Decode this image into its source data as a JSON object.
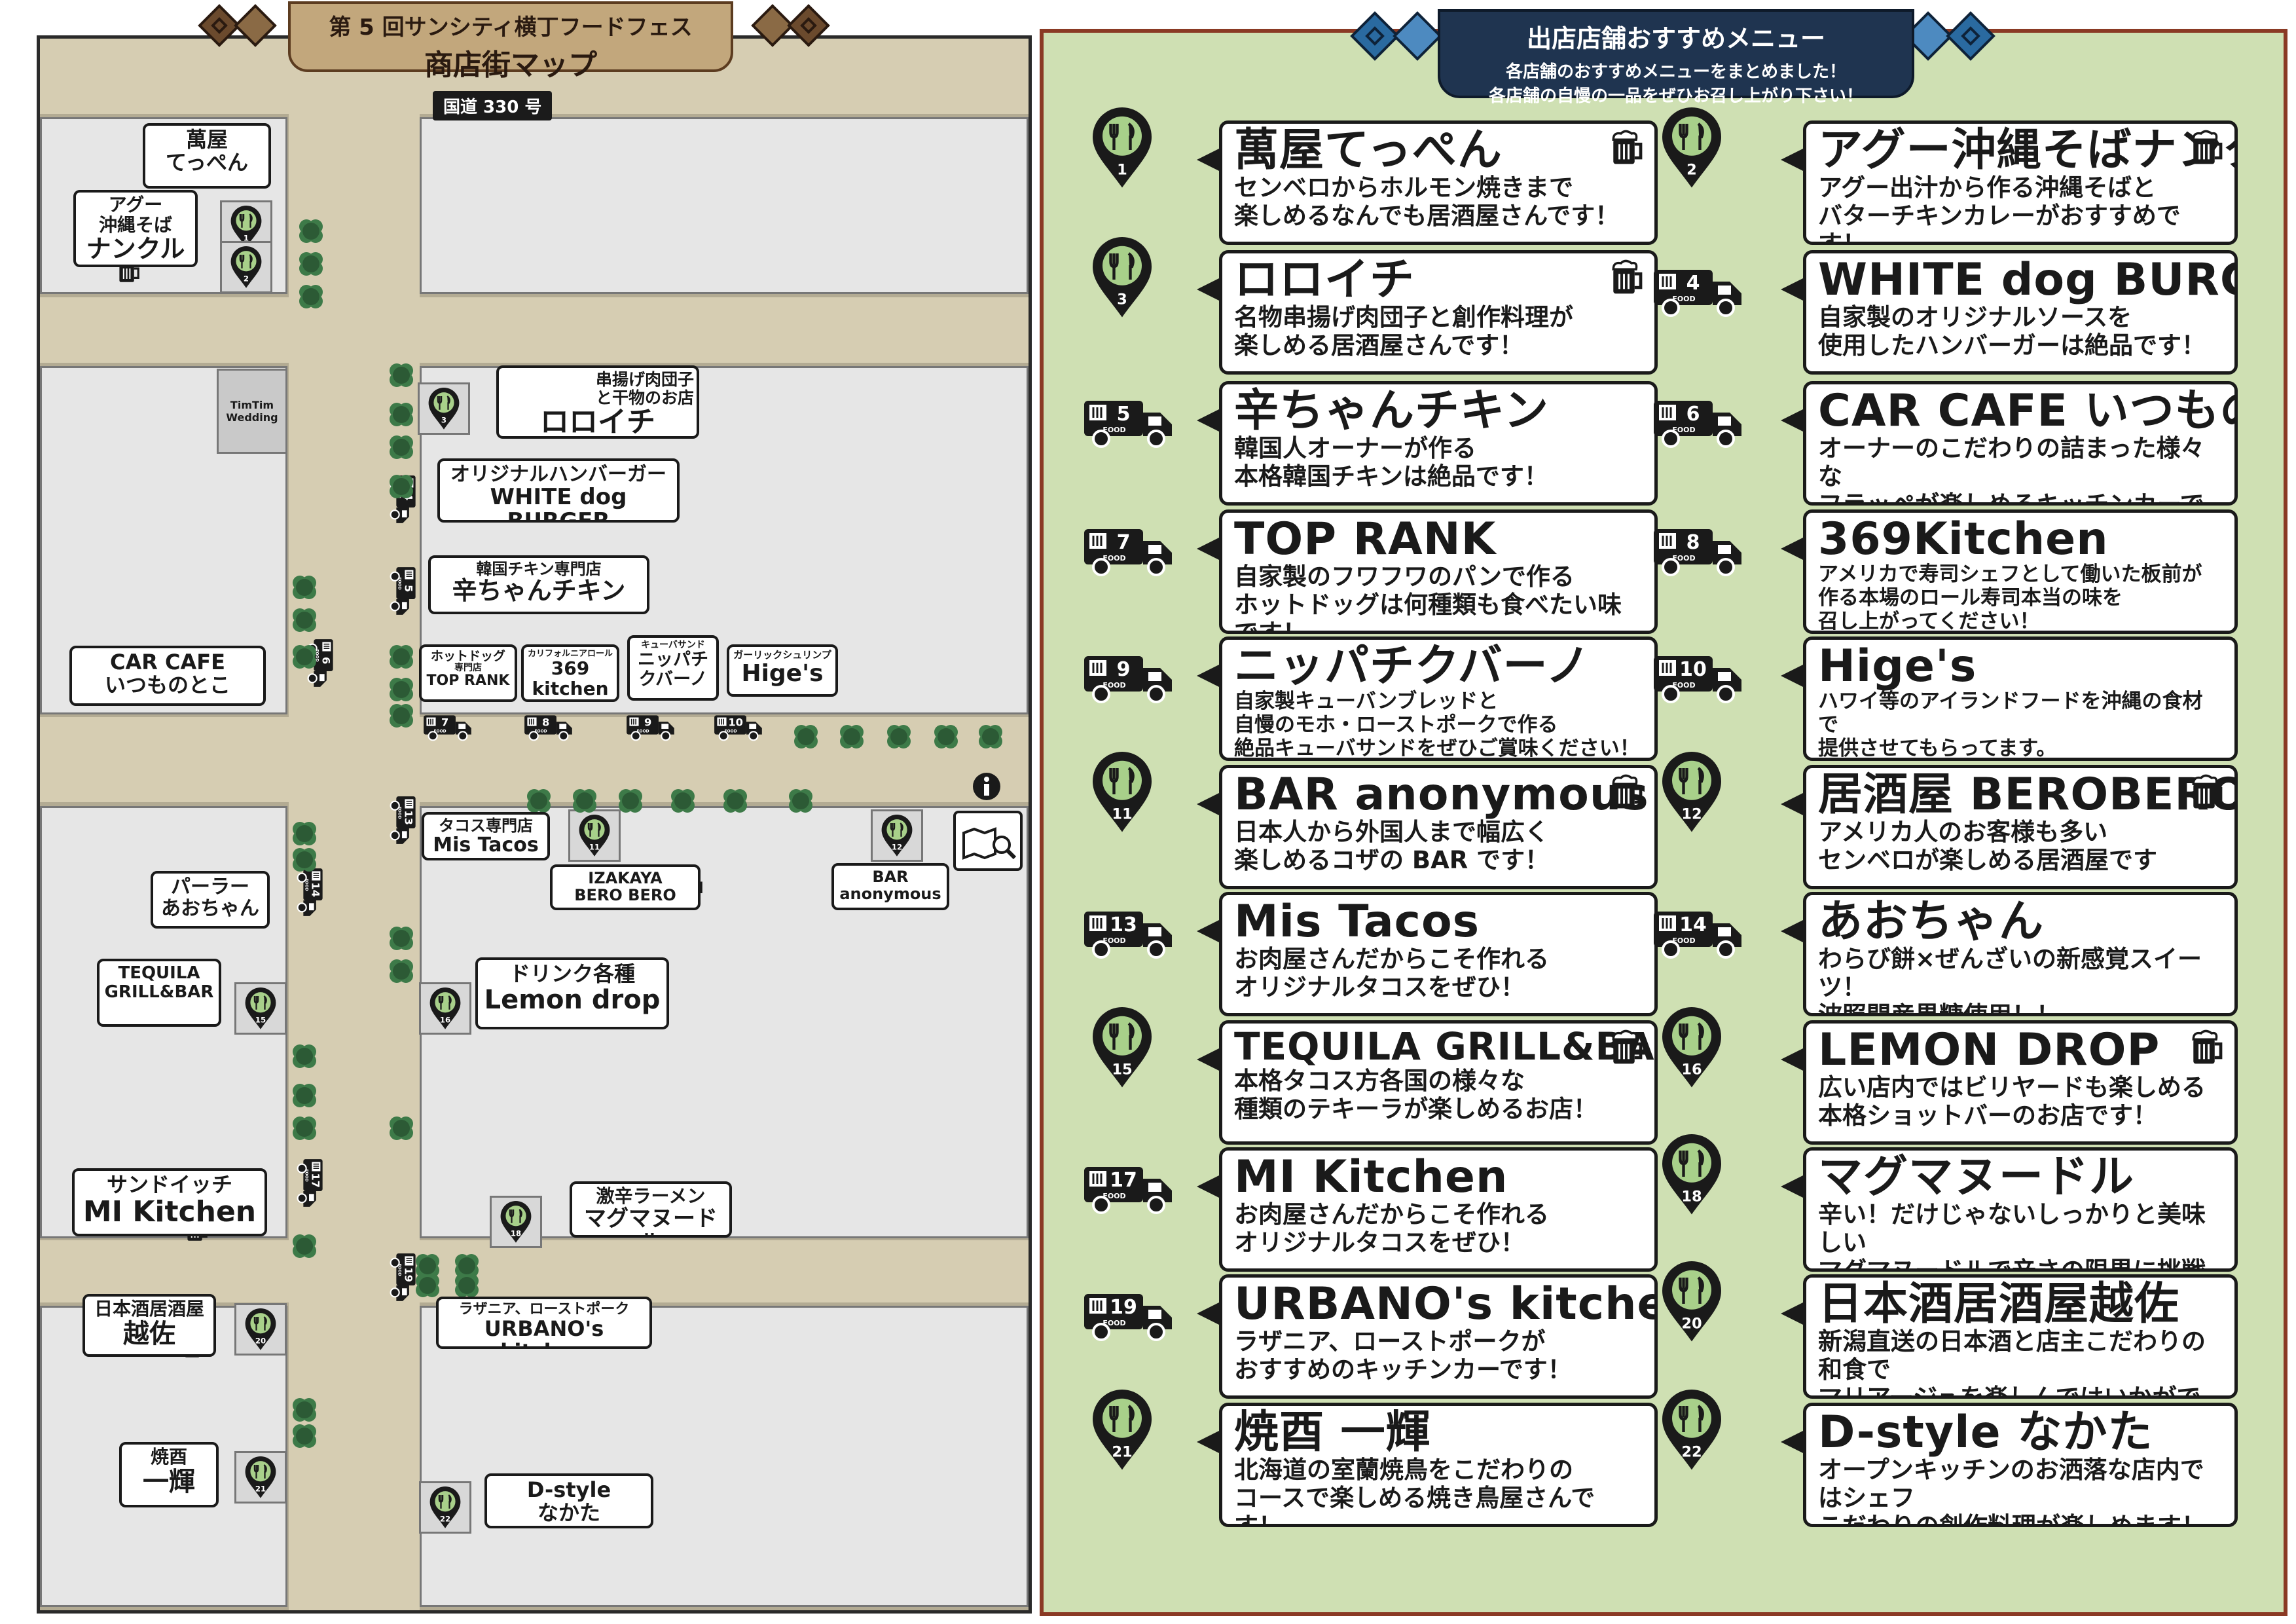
{
  "colors": {
    "map_bg": "#b3ab93",
    "road": "#d6cdb2",
    "block": "#e6e6e6",
    "menu_bg": "#cfe0b3",
    "menu_border": "#8a3a24",
    "map_banner": "#6b4a2d",
    "menu_banner": "#1f3450",
    "tree": "#2c5a35"
  },
  "map": {
    "banner": {
      "line1": "第 5 回サンシティ横丁フードフェス",
      "line2": "商店街マップ"
    },
    "road_label": "国道 330 号",
    "wedding": "TimTim Wedding",
    "pins": [
      {
        "num": "1"
      },
      {
        "num": "2"
      },
      {
        "num": "3"
      },
      {
        "num": "11"
      },
      {
        "num": "12"
      },
      {
        "num": "15"
      },
      {
        "num": "16"
      },
      {
        "num": "18"
      },
      {
        "num": "20"
      },
      {
        "num": "21"
      },
      {
        "num": "22"
      }
    ],
    "trucks": [
      {
        "num": "4"
      },
      {
        "num": "5"
      },
      {
        "num": "6"
      },
      {
        "num": "7"
      },
      {
        "num": "8"
      },
      {
        "num": "9"
      },
      {
        "num": "10"
      },
      {
        "num": "13"
      },
      {
        "num": "14"
      },
      {
        "num": "17"
      },
      {
        "num": "19"
      }
    ],
    "labels": {
      "teppen": [
        "萬屋",
        "てっぺん"
      ],
      "nankuru": [
        "アグー",
        "沖縄そば",
        "ナンクル"
      ],
      "roroichi": [
        "串揚げ肉団子",
        "と干物のお店",
        "ロロイチ"
      ],
      "whitedog": [
        "オリジナルハンバーガー",
        "WHITE dog BURGER"
      ],
      "karachan": [
        "韓国チキン専門店",
        "辛ちゃんチキン"
      ],
      "carcafe": [
        "CAR CAFE",
        "いつものとこ"
      ],
      "toprank": [
        "ホットドッグ",
        "専門店",
        "TOP RANK"
      ],
      "k369": [
        "カリフォルニアロール",
        "369",
        "kitchen"
      ],
      "nippachi": [
        "キューバサンド",
        "ニッパチ",
        "クバーノ"
      ],
      "higes": [
        "ガーリックシュリンプ",
        "Hige's"
      ],
      "mistacos": [
        "タコス専門店",
        "Mis Tacos"
      ],
      "berobero": [
        "IZAKAYA",
        "BERO BERO"
      ],
      "bar": [
        "BAR",
        "anonymous"
      ],
      "aochan": [
        "パーラー",
        "あおちゃん"
      ],
      "tequila": [
        "TEQUILA",
        "GRILL&BAR"
      ],
      "lemon": [
        "ドリンク各種",
        "Lemon drop"
      ],
      "mi": [
        "サンドイッチ",
        "MI Kitchen"
      ],
      "magma": [
        "激辛ラーメン",
        "マグマヌードル"
      ],
      "urbano": [
        "ラザニア、ローストポーク",
        "URBANO's kitchen"
      ],
      "etsusa": [
        "日本酒居酒屋",
        "越佐"
      ],
      "ikki": [
        "焼酉",
        "一輝"
      ],
      "dstyle": [
        "D-style",
        "なかた"
      ]
    }
  },
  "menu": {
    "banner": {
      "title": "出店店舗おすすめメニュー",
      "sub1": "各店舗のおすすめメニューをまとめました！",
      "sub2": "各店舗の自慢の一品をぜひお召し上がり下さい！"
    },
    "items": [
      {
        "num": "1",
        "type": "pin",
        "name": "萬屋てっぺん",
        "desc": "センベロからホルモン焼きまで\n楽しめるなんでも居酒屋さんです！"
      },
      {
        "num": "2",
        "type": "pin",
        "name": "アグー沖縄そばナンクル",
        "desc": "アグー出汁から作る沖縄そばと\nバターチキンカレーがおすすめです！"
      },
      {
        "num": "3",
        "type": "pin",
        "name": "ロロイチ",
        "desc": "名物串揚げ肉団子と創作料理が\n楽しめる居酒屋さんです！"
      },
      {
        "num": "4",
        "type": "truck",
        "name": "WHITE dog BURGER",
        "desc": "自家製のオリジナルソースを\n使用したハンバーガーは絶品です！"
      },
      {
        "num": "5",
        "type": "truck",
        "name": "辛ちゃんチキン",
        "desc": "韓国人オーナーが作る\n本格韓国チキンは絶品です！"
      },
      {
        "num": "6",
        "type": "truck",
        "name": "CAR CAFE いつものとこ",
        "desc": "オーナーのこだわりの詰まった様々な\nフラッペが楽しめるキッチンカーです！"
      },
      {
        "num": "7",
        "type": "truck",
        "name": "TOP RANK",
        "desc": "自家製のフワフワのパンで作る\nホットドッグは何種類も食べたい味です！"
      },
      {
        "num": "8",
        "type": "truck",
        "name": "369Kitchen",
        "desc": "アメリカで寿司シェフとして働いた板前が\n作る本場のロール寿司本当の味を\n召し上がってください！"
      },
      {
        "num": "9",
        "type": "truck",
        "name": "ニッパチクバーノ",
        "desc": "自家製キューバンブレッドと\n自慢のモホ・ローストポークで作る\n絶品キューバサンドをぜひご賞味ください！"
      },
      {
        "num": "10",
        "type": "truck",
        "name": "Hige's",
        "desc": "ハワイ等のアイランドフードを沖縄の食材で\n提供させてもらってます。\nガーリックシュリンプがおすすめです！"
      },
      {
        "num": "11",
        "type": "pin",
        "name": "BAR anonymous",
        "desc": "日本人から外国人まで幅広く\n楽しめるコザの BAR です！"
      },
      {
        "num": "12",
        "type": "pin",
        "name": "居酒屋 BEROBERO",
        "desc": "アメリカ人のお客様も多い\nセンベロが楽しめる居酒屋です"
      },
      {
        "num": "13",
        "type": "truck",
        "name": "Mis Tacos",
        "desc": "お肉屋さんだからこそ作れる\nオリジナルタコスをぜひ！"
      },
      {
        "num": "14",
        "type": "truck",
        "name": "あおちゃん",
        "desc": "わらび餅×ぜんざいの新感覚スイーツ！\n波照間産黒糖使用！！"
      },
      {
        "num": "15",
        "type": "pin",
        "name": "TEQUILA GRILL&BAR",
        "desc": "本格タコス方各国の様々な\n種類のテキーラが楽しめるお店！"
      },
      {
        "num": "16",
        "type": "pin",
        "name": "LEMON DROP",
        "desc": "広い店内ではビリヤードも楽しめる\n本格ショットバーのお店です！"
      },
      {
        "num": "17",
        "type": "truck",
        "name": "MI Kitchen",
        "desc": "お肉屋さんだからこそ作れる\nオリジナルタコスをぜひ！"
      },
      {
        "num": "18",
        "type": "pin",
        "name": "マグマヌードル",
        "desc": "辛い！だけじゃないしっかりと美味しい\nマグマヌードルで辛さの限界に挑戦してみては！？"
      },
      {
        "num": "19",
        "type": "truck",
        "name": "URBANO's kitchen",
        "desc": "ラザニア、ローストポークが\nおすすめのキッチンカーです！"
      },
      {
        "num": "20",
        "type": "pin",
        "name": "日本酒居酒屋越佐",
        "desc": "新潟直送の日本酒と店主こだわりの和食で\nマリアージュを楽しんではいかがでしょうか！？"
      },
      {
        "num": "21",
        "type": "pin",
        "name": "焼酉 一輝",
        "desc": "北海道の室蘭焼鳥をこだわりの\nコースで楽しめる焼き鳥屋さんです！"
      },
      {
        "num": "22",
        "type": "pin",
        "name": "D-style なかた",
        "desc": "オープンキッチンのお洒落な店内ではシェフ\nこだわりの創作料理が楽しめます！"
      }
    ]
  }
}
